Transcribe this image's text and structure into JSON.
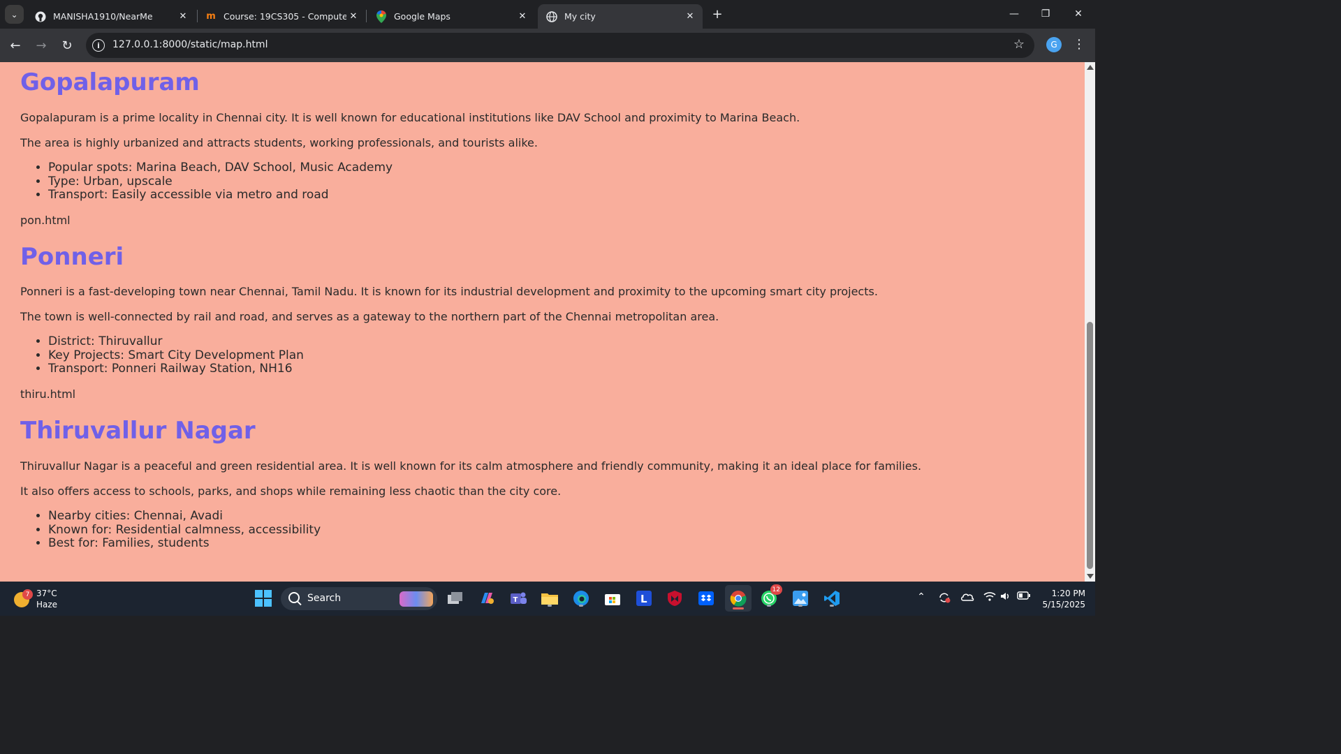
{
  "browser": {
    "tabs": [
      {
        "title": "MANISHA1910/NearMe",
        "icon": "github-icon"
      },
      {
        "title": "Course: 19CS305 - Computer A",
        "icon": "moodle-icon"
      },
      {
        "title": "Google Maps",
        "icon": "google-maps-icon"
      },
      {
        "title": "My city",
        "icon": "globe-icon",
        "active": true
      }
    ],
    "url": "127.0.0.1:8000/static/map.html",
    "profile_initial": "G"
  },
  "page": {
    "background": "#f9ae9c",
    "heading_color": "#7060e8",
    "sections": [
      {
        "title": "Gopalapuram",
        "paragraphs": [
          "Gopalapuram is a prime locality in Chennai city. It is well known for educational institutions like DAV School and proximity to Marina Beach.",
          "The area is highly urbanized and attracts students, working professionals, and tourists alike."
        ],
        "items": [
          "Popular spots: Marina Beach, DAV School, Music Academy",
          "Type: Urban, upscale",
          "Transport: Easily accessible via metro and road"
        ],
        "link_text": "pon.html"
      },
      {
        "title": "Ponneri",
        "paragraphs": [
          "Ponneri is a fast-developing town near Chennai, Tamil Nadu. It is known for its industrial development and proximity to the upcoming smart city projects.",
          "The town is well-connected by rail and road, and serves as a gateway to the northern part of the Chennai metropolitan area."
        ],
        "items": [
          "District: Thiruvallur",
          "Key Projects: Smart City Development Plan",
          "Transport: Ponneri Railway Station, NH16"
        ],
        "link_text": "thiru.html"
      },
      {
        "title": "Thiruvallur Nagar",
        "paragraphs": [
          "Thiruvallur Nagar is a peaceful and green residential area. It is well known for its calm atmosphere and friendly community, making it an ideal place for families.",
          "It also offers access to schools, parks, and shops while remaining less chaotic than the city core."
        ],
        "items": [
          "Nearby cities: Chennai, Avadi",
          "Known for: Residential calmness, accessibility",
          "Best for: Families, students"
        ]
      }
    ]
  },
  "taskbar": {
    "weather": {
      "temp": "37°C",
      "condition": "Haze",
      "badge": "7"
    },
    "search_label": "Search",
    "whatsapp_badge": "12",
    "clock": {
      "time": "1:20 PM",
      "date": "5/15/2025"
    }
  }
}
